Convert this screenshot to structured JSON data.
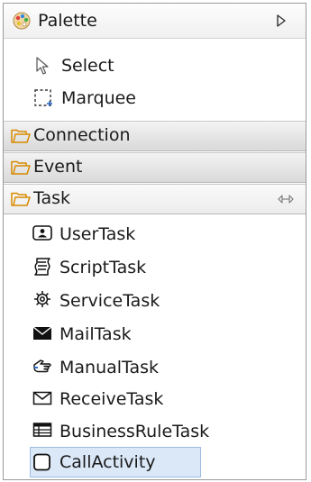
{
  "palette": {
    "title": "Palette",
    "collapse_icon": "triangle-right-icon"
  },
  "tools": [
    {
      "label": "Select",
      "icon": "select-arrow-icon"
    },
    {
      "label": "Marquee",
      "icon": "marquee-icon"
    }
  ],
  "drawers": [
    {
      "label": "Connection",
      "state": "collapsed"
    },
    {
      "label": "Event",
      "state": "collapsed"
    },
    {
      "label": "Task",
      "state": "expanded"
    }
  ],
  "tasks": [
    {
      "label": "UserTask",
      "icon": "user-task-icon"
    },
    {
      "label": "ScriptTask",
      "icon": "script-task-icon"
    },
    {
      "label": "ServiceTask",
      "icon": "gear-icon"
    },
    {
      "label": "MailTask",
      "icon": "mail-filled-icon"
    },
    {
      "label": "ManualTask",
      "icon": "hand-icon"
    },
    {
      "label": "ReceiveTask",
      "icon": "envelope-icon"
    },
    {
      "label": "BusinessRuleTask",
      "icon": "table-icon"
    },
    {
      "label": "CallActivity",
      "icon": "rounded-square-icon",
      "selected": true
    }
  ],
  "colors": {
    "selection_bg": "#dbe8f8",
    "selection_border": "#9fbde3",
    "folder": "#e8a317"
  }
}
